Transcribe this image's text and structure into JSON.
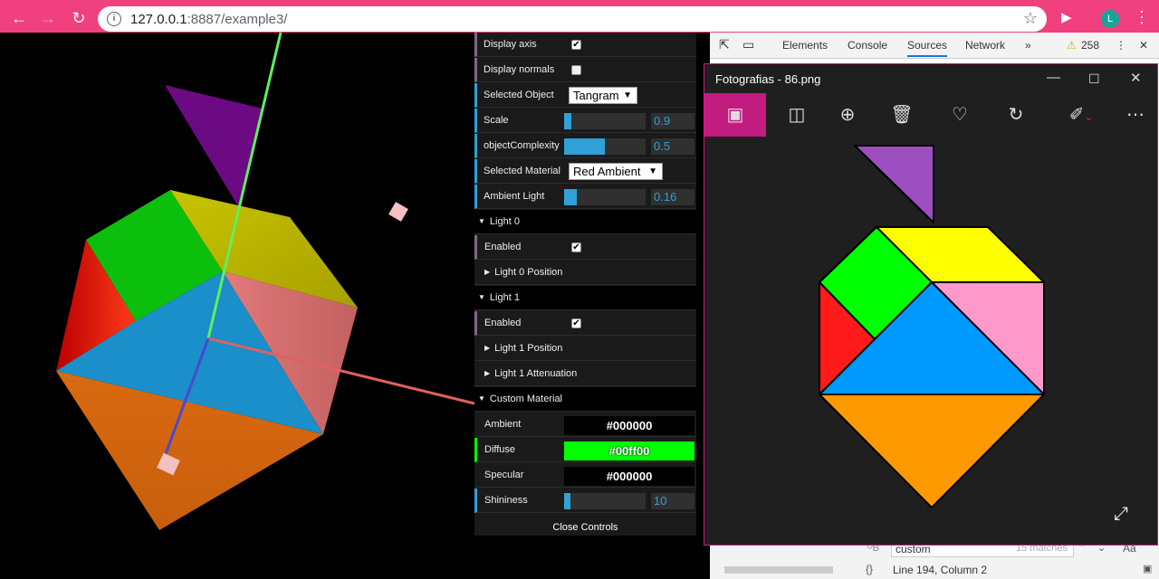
{
  "browser": {
    "url_host": "127.0.0.1",
    "url_rest": ":8887/example3/",
    "avatar_letter": "L"
  },
  "gui": {
    "display_axis": {
      "label": "Display axis",
      "checked": true
    },
    "display_normals": {
      "label": "Display normals",
      "checked": false
    },
    "selected_object": {
      "label": "Selected Object",
      "value": "Tangram"
    },
    "scale": {
      "label": "Scale",
      "value": "0.9",
      "fraction": 0.09
    },
    "complexity": {
      "label": "objectComplexity",
      "value": "0.5",
      "fraction": 0.5
    },
    "selected_material": {
      "label": "Selected Material",
      "value": "Red Ambient"
    },
    "ambient_light": {
      "label": "Ambient Light",
      "value": "0.16",
      "fraction": 0.16
    },
    "light0": {
      "label": "Light 0",
      "enabled_label": "Enabled",
      "position_label": "Light 0 Position"
    },
    "light1": {
      "label": "Light 1",
      "enabled_label": "Enabled",
      "position_label": "Light 1 Position",
      "attenuation_label": "Light 1 Attenuation"
    },
    "custom_material": {
      "label": "Custom Material",
      "ambient": {
        "label": "Ambient",
        "value": "#000000"
      },
      "diffuse": {
        "label": "Diffuse",
        "value": "#00ff00"
      },
      "specular": {
        "label": "Specular",
        "value": "#000000"
      },
      "shininess": {
        "label": "Shininess",
        "value": "10",
        "fraction": 0.06
      }
    },
    "close_label": "Close Controls"
  },
  "devtools": {
    "tabs": [
      "Elements",
      "Console",
      "Sources",
      "Network"
    ],
    "active_tab": "Sources",
    "warnings": "258",
    "search_value": "custom",
    "matches": "15 matches",
    "status": "Line 194, Column 2"
  },
  "photos": {
    "title": "Fotografias - 86.png"
  },
  "colors": {
    "chrome": "#f0407d",
    "gui_bg": "#1a1a1a",
    "accent_blue": "#2fa1d6",
    "photos_accent": "#c11c80"
  }
}
